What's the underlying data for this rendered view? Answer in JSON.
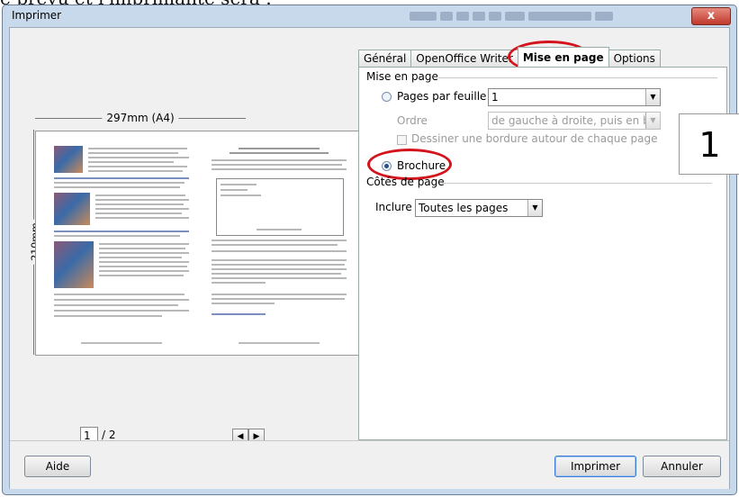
{
  "background_text": "e prévu et l'imprimante sera :",
  "window": {
    "title": "Imprimer",
    "close_label": "x"
  },
  "preview": {
    "paper_width": "297mm (A4)",
    "paper_height": "210mm",
    "page_current": "1",
    "page_total": "/ 2",
    "prev_icon": "◀",
    "next_icon": "▶"
  },
  "tabs": [
    {
      "label": "Général",
      "active": false
    },
    {
      "label": "OpenOffice Writer",
      "active": false
    },
    {
      "label": "Mise en page",
      "active": true
    },
    {
      "label": "Options",
      "active": false
    }
  ],
  "layout": {
    "section_title": "Mise en page",
    "pages_per_sheet_label": "Pages par feuille",
    "pages_per_sheet_value": "1",
    "order_label": "Ordre",
    "order_value": "de gauche à droite, puis en bas",
    "border_label": "Dessiner une bordure autour de chaque page",
    "brochure_label": "Brochure",
    "preview_number": "1"
  },
  "sides": {
    "section_title": "Côtés de page",
    "include_label": "Inclure",
    "include_value": "Toutes les pages"
  },
  "buttons": {
    "help": "Aide",
    "print": "Imprimer",
    "cancel": "Annuler"
  },
  "accent_colors": {
    "annotation_ring": "#d4141c",
    "window_frame": "#c9d9ec"
  }
}
